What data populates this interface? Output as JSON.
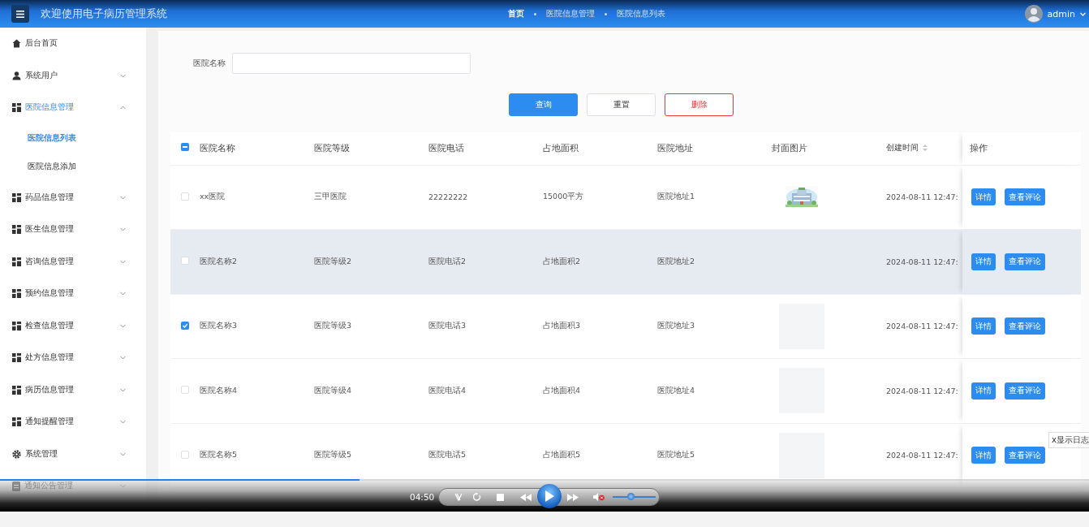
{
  "header": {
    "title": "欢迎使用电子病历管理系统",
    "breadcrumbs": [
      "首页",
      "医院信息管理",
      "医院信息列表"
    ],
    "user": "admin"
  },
  "sidebar": {
    "items": [
      {
        "label": "后台首页",
        "kind": "home",
        "selected": false
      },
      {
        "label": "系统用户",
        "kind": "user",
        "expanded": false,
        "selected": false
      },
      {
        "label": "医院信息管理",
        "kind": "grid",
        "expanded": true,
        "selected": true,
        "children": [
          {
            "label": "医院信息列表",
            "selected": true
          },
          {
            "label": "医院信息添加",
            "selected": false
          }
        ]
      },
      {
        "label": "药品信息管理",
        "kind": "grid",
        "expanded": false,
        "selected": false
      },
      {
        "label": "医生信息管理",
        "kind": "grid",
        "expanded": false,
        "selected": false
      },
      {
        "label": "咨询信息管理",
        "kind": "grid",
        "expanded": false,
        "selected": false
      },
      {
        "label": "预约信息管理",
        "kind": "grid",
        "expanded": false,
        "selected": false
      },
      {
        "label": "检查信息管理",
        "kind": "grid",
        "expanded": false,
        "selected": false
      },
      {
        "label": "处方信息管理",
        "kind": "grid",
        "expanded": false,
        "selected": false
      },
      {
        "label": "病历信息管理",
        "kind": "grid",
        "expanded": false,
        "selected": false
      },
      {
        "label": "通知提醒管理",
        "kind": "grid",
        "expanded": false,
        "selected": false
      },
      {
        "label": "系统管理",
        "kind": "gear",
        "expanded": false,
        "selected": false
      },
      {
        "label": "通知公告管理",
        "kind": "doc",
        "expanded": false,
        "selected": false
      }
    ]
  },
  "search": {
    "label": "医院名称"
  },
  "buttons": [
    {
      "label": "查询",
      "kind": "primary"
    },
    {
      "label": "重置",
      "kind": "default"
    },
    {
      "label": "删除",
      "kind": "danger"
    }
  ],
  "table": {
    "select_all": {
      "indeterminate": true
    },
    "columns": [
      {
        "label": "医院名称",
        "sortable": false
      },
      {
        "label": "医院等级",
        "sortable": false
      },
      {
        "label": "医院电话",
        "sortable": false
      },
      {
        "label": "占地面积",
        "sortable": false
      },
      {
        "label": "医院地址",
        "sortable": false
      },
      {
        "label": "封面图片",
        "sortable": false
      },
      {
        "label": "创建时间",
        "sortable": true
      },
      {
        "label": "操作",
        "sortable": false
      }
    ],
    "rows": [
      {
        "checked": false,
        "highlighted": false,
        "cells": [
          "xx医院",
          "三甲医院",
          "22222222",
          "15000平方",
          "医院地址1"
        ],
        "cover": {
          "kind": "picture"
        },
        "created": "2024-08-11 12:47:",
        "actions": [
          "详情",
          "查看评论"
        ]
      },
      {
        "checked": false,
        "highlighted": true,
        "cells": [
          "医院名称2",
          "医院等级2",
          "医院电话2",
          "占地面积2",
          "医院地址2"
        ],
        "created": "2024-08-11 12:47:",
        "actions": [
          "详情",
          "查看评论"
        ]
      },
      {
        "checked": true,
        "highlighted": false,
        "cells": [
          "医院名称3",
          "医院等级3",
          "医院电话3",
          "占地面积3",
          "医院地址3"
        ],
        "cover": {
          "kind": "blank"
        },
        "created": "2024-08-11 12:47:",
        "actions": [
          "详情",
          "查看评论"
        ]
      },
      {
        "checked": false,
        "highlighted": false,
        "cells": [
          "医院名称4",
          "医院等级4",
          "医院电话4",
          "占地面积4",
          "医院地址4"
        ],
        "cover": {
          "kind": "blank"
        },
        "created": "2024-08-11 12:47:",
        "actions": [
          "详情",
          "查看评论"
        ]
      },
      {
        "checked": false,
        "highlighted": false,
        "cells": [
          "医院名称5",
          "医院等级5",
          "医院电话5",
          "占地面积5",
          "医院地址5"
        ],
        "cover": {
          "kind": "blank"
        },
        "created": "2024-08-11 12:47:",
        "actions": [
          "详情",
          "查看评论"
        ]
      }
    ]
  },
  "tooltip": "x显示日志",
  "player": {
    "time": "04:50",
    "progress": {
      "level": 0.33
    },
    "volume": {
      "level": 0.43
    },
    "muted": true
  }
}
